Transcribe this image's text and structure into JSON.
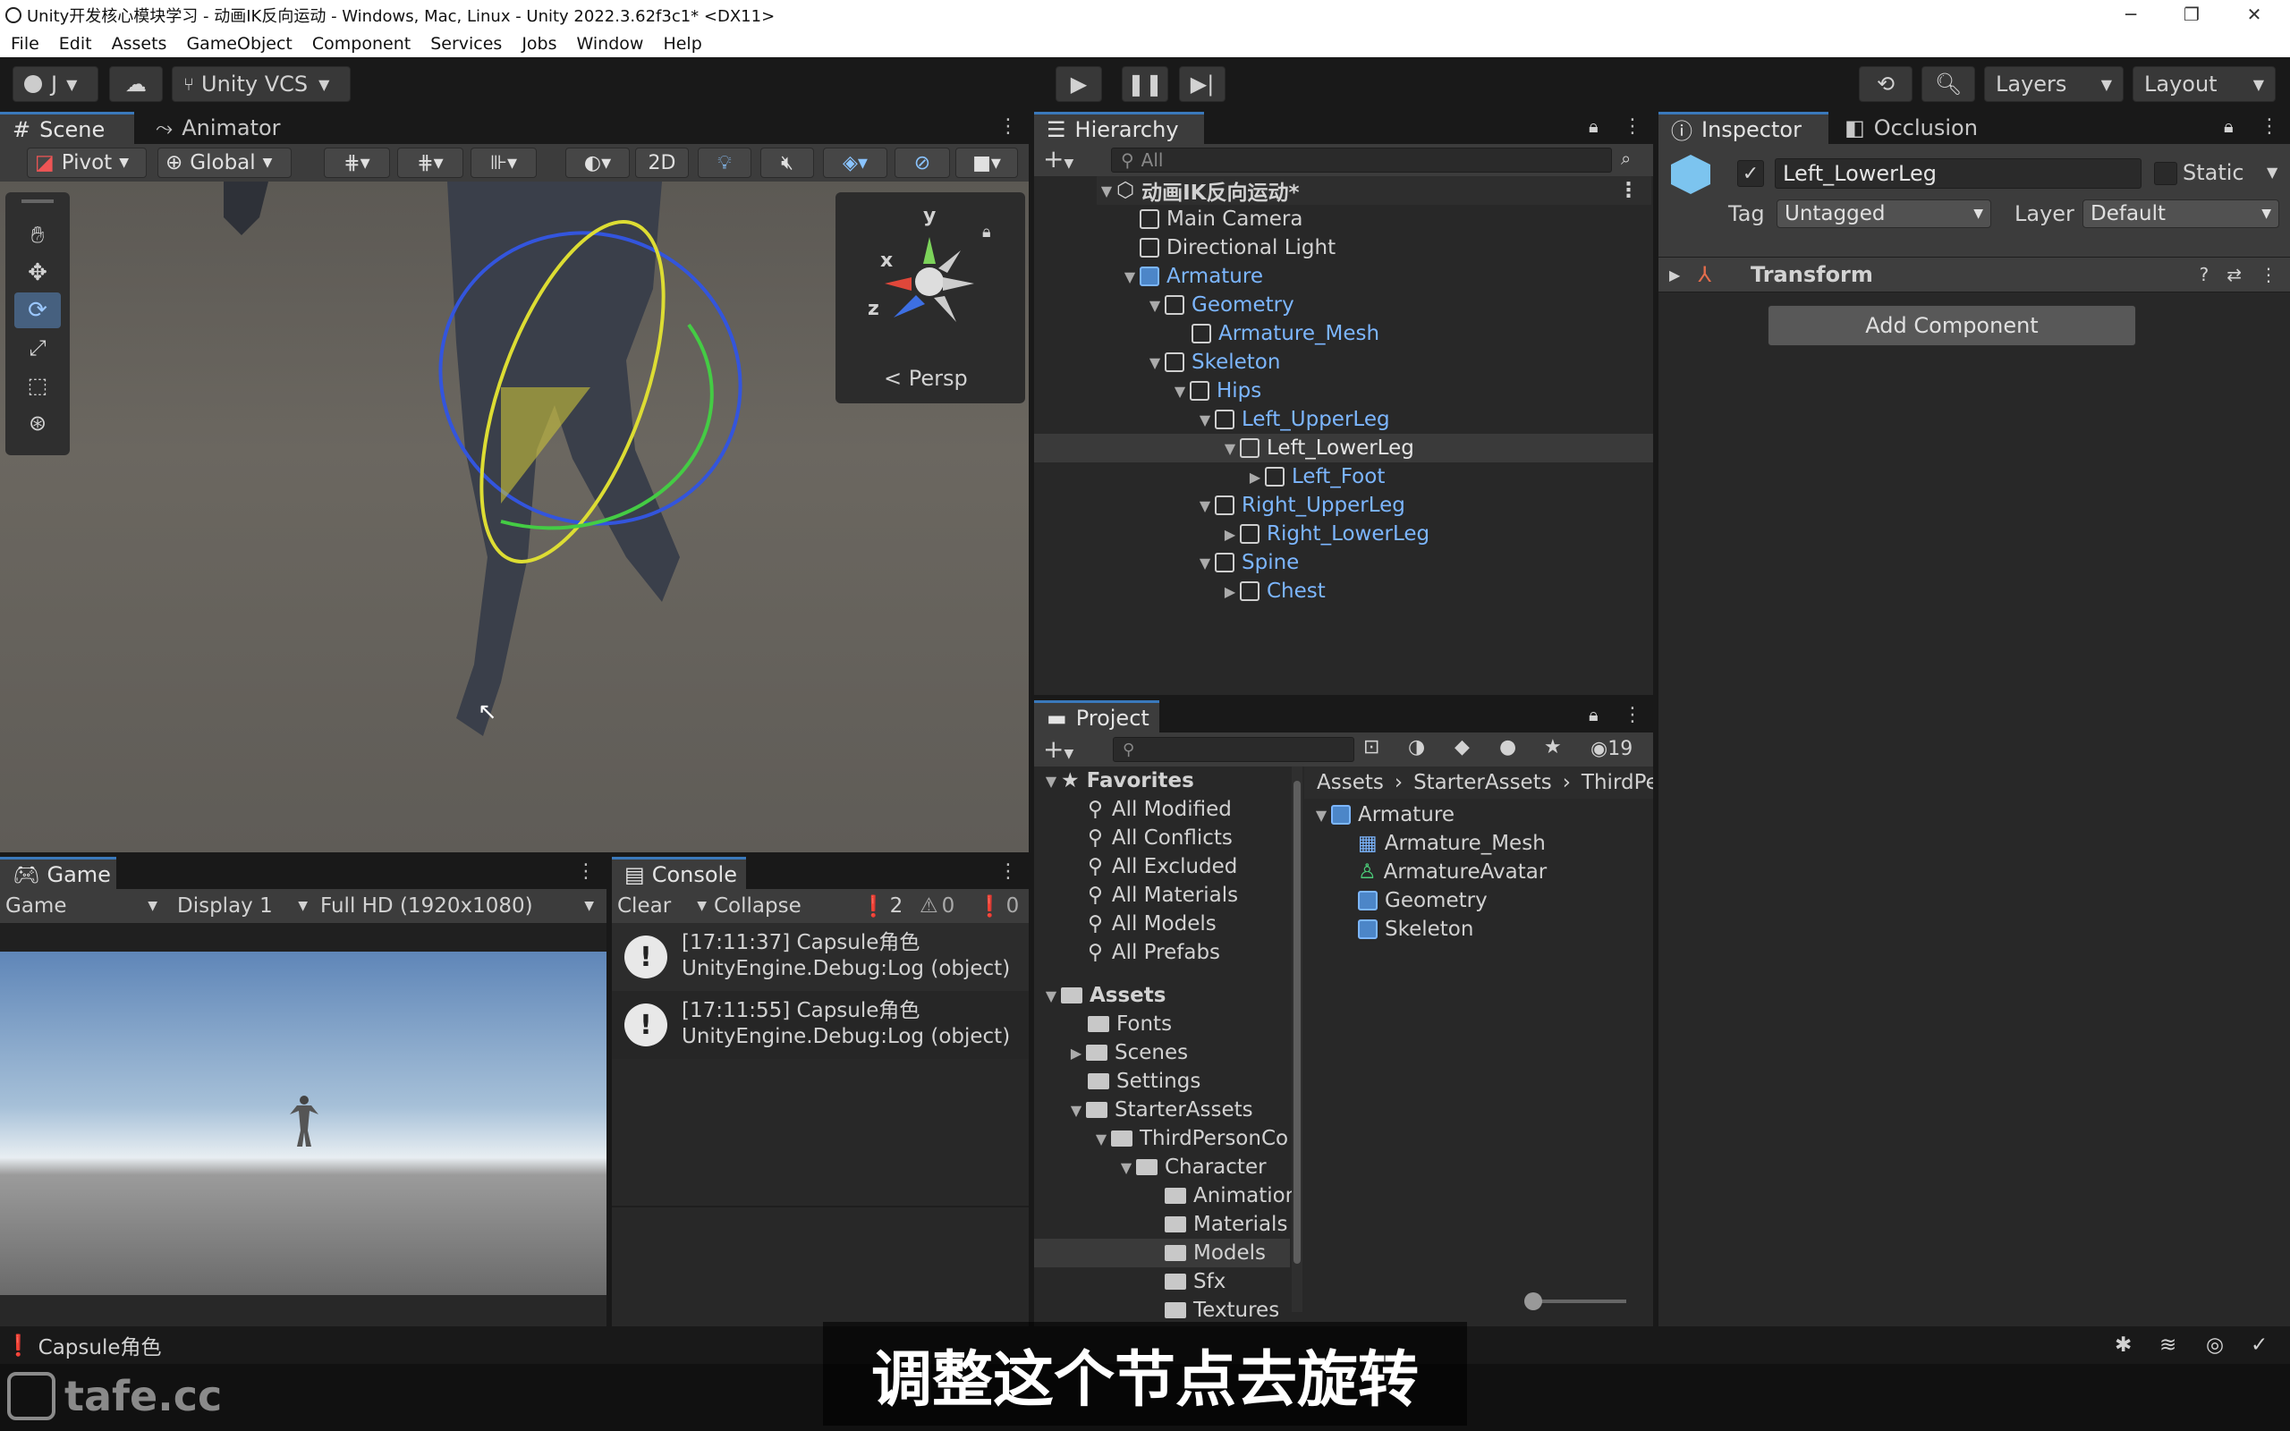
{
  "window": {
    "title": "Unity开发核心模块学习 - 动画IK反向运动 - Windows, Mac, Linux - Unity 2022.3.62f3c1* <DX11>"
  },
  "menu": [
    "File",
    "Edit",
    "Assets",
    "GameObject",
    "Component",
    "Services",
    "Jobs",
    "Window",
    "Help"
  ],
  "toolbar": {
    "account": "J",
    "vcs": "Unity VCS",
    "layers": "Layers",
    "layout": "Layout"
  },
  "scene": {
    "tabs": [
      "Scene",
      "Animator"
    ],
    "pivot": "Pivot",
    "global": "Global",
    "mode2d": "2D",
    "gizmo": {
      "y": "y",
      "x": "x",
      "z": "z",
      "persp": "Persp"
    }
  },
  "game": {
    "tab": "Game",
    "mode": "Game",
    "display": "Display 1",
    "resolution": "Full HD (1920x1080)"
  },
  "console": {
    "tab": "Console",
    "clear": "Clear",
    "collapse": "Collapse",
    "count_log": "2",
    "count_warn": "0",
    "count_err": "0",
    "entries": [
      {
        "line1": "[17:11:37] Capsule角色",
        "line2": "UnityEngine.Debug:Log (object)"
      },
      {
        "line1": "[17:11:55] Capsule角色",
        "line2": "UnityEngine.Debug:Log (object)"
      }
    ]
  },
  "hierarchy": {
    "tab": "Hierarchy",
    "search_placeholder": "All",
    "items": [
      {
        "label": "动画IK反向运动*"
      },
      {
        "label": "Main Camera"
      },
      {
        "label": "Directional Light"
      },
      {
        "label": "Armature"
      },
      {
        "label": "Geometry"
      },
      {
        "label": "Armature_Mesh"
      },
      {
        "label": "Skeleton"
      },
      {
        "label": "Hips"
      },
      {
        "label": "Left_UpperLeg"
      },
      {
        "label": "Left_LowerLeg"
      },
      {
        "label": "Left_Foot"
      },
      {
        "label": "Right_UpperLeg"
      },
      {
        "label": "Right_LowerLeg"
      },
      {
        "label": "Spine"
      },
      {
        "label": "Chest"
      }
    ]
  },
  "project": {
    "tab": "Project",
    "hidden_count": "19",
    "breadcrumb": [
      "Assets",
      "StarterAssets",
      "ThirdPe"
    ],
    "favorites_label": "Favorites",
    "favorites": [
      "All Modified",
      "All Conflicts",
      "All Excluded",
      "All Materials",
      "All Models",
      "All Prefabs"
    ],
    "assets_label": "Assets",
    "folders": [
      "Fonts",
      "Scenes",
      "Settings",
      "StarterAssets",
      "ThirdPersonCo",
      "Character",
      "Animation",
      "Materials",
      "Models",
      "Sfx",
      "Textures"
    ],
    "contents": [
      "Armature",
      "Armature_Mesh",
      "ArmatureAvatar",
      "Geometry",
      "Skeleton"
    ]
  },
  "inspector": {
    "tabs": [
      "Inspector",
      "Occlusion"
    ],
    "object_name": "Left_LowerLeg",
    "static_label": "Static",
    "tag_label": "Tag",
    "tag_value": "Untagged",
    "layer_label": "Layer",
    "layer_value": "Default",
    "component": "Transform",
    "add_component": "Add Component"
  },
  "status": {
    "message": "Capsule角色"
  },
  "subtitle": "调整这个节点去旋转",
  "watermark": "tafe.cc"
}
